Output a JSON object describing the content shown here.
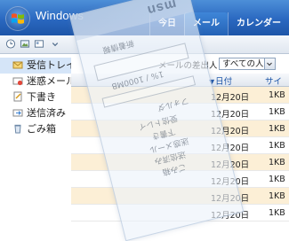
{
  "titlebar": {
    "brand": "Windows",
    "tabs": [
      {
        "label": "今日",
        "active": false
      },
      {
        "label": "メール",
        "active": true
      },
      {
        "label": "カレンダー",
        "active": false
      }
    ]
  },
  "folders": [
    {
      "label": "受信トレイ",
      "icon": "inbox-icon",
      "selected": true
    },
    {
      "label": "迷惑メール",
      "icon": "junk-icon",
      "selected": false
    },
    {
      "label": "下書き",
      "icon": "drafts-icon",
      "selected": false
    },
    {
      "label": "送信済み",
      "icon": "sent-icon",
      "selected": false
    },
    {
      "label": "ごみ箱",
      "icon": "trash-icon",
      "selected": false
    }
  ],
  "filter": {
    "label": "メールの差出人：",
    "value": "すべての人"
  },
  "columns": {
    "date": "日付",
    "size": "サイズ"
  },
  "messages": [
    {
      "date": "12月20日",
      "size": "1KB"
    },
    {
      "date": "12月20日",
      "size": "1KB"
    },
    {
      "date": "12月20日",
      "size": "1KB"
    },
    {
      "date": "12月20日",
      "size": "1KB"
    },
    {
      "date": "12月20日",
      "size": "1KB"
    },
    {
      "date": "12月20日",
      "size": "1KB"
    },
    {
      "date": "12月20日",
      "size": "1KB"
    },
    {
      "date": "12月20日",
      "size": "1KB"
    }
  ],
  "overlay": {
    "logo": "msn",
    "header_text": "新着情報",
    "quota": "1% / 1000MB",
    "folder_title": "フォルダ",
    "items": [
      "受信トレイ",
      "下書き",
      "迷惑メール",
      "送信済み",
      "ごみ箱"
    ]
  },
  "colors": {
    "titlebar": "#2a68c0",
    "selected_folder": "#d5e5f8",
    "unread_row": "#fcefd6",
    "header_text": "#1f56a8"
  }
}
